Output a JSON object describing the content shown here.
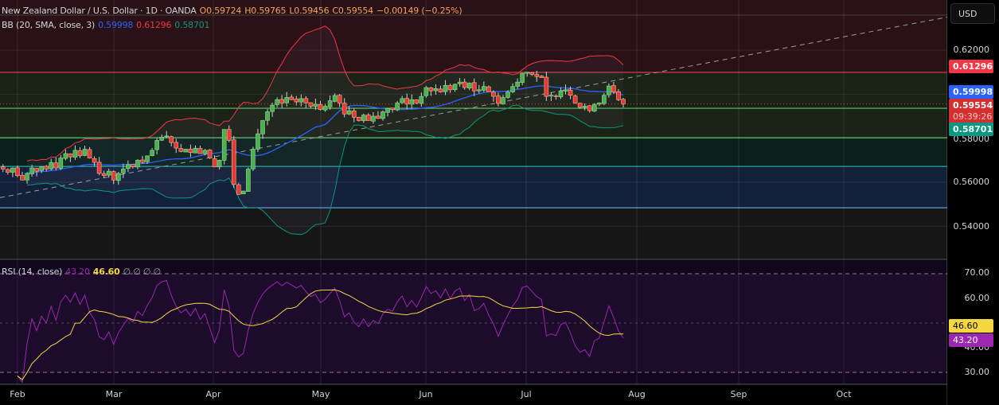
{
  "header": {
    "symbol": "New Zealand Dollar / U.S. Dollar · 1D · OANDA",
    "open_label": "O",
    "open": "0.59724",
    "high_label": "H",
    "high": "0.59765",
    "low_label": "L",
    "low": "0.59456",
    "close_label": "C",
    "close": "0.59554",
    "change": "−0.00149 (−0.25%)"
  },
  "bb_legend": {
    "label": "BB (20, SMA, close, 3)",
    "basis": "0.59998",
    "upper": "0.61296",
    "lower": "0.58701"
  },
  "rsi_legend": {
    "label": "RSI (14, close)",
    "rsi": "43.20",
    "ma": "46.60",
    "extras": "∅ ∅ ∅ ∅"
  },
  "currency_button": "USD",
  "price_axis": [
    "0.62000",
    "0.58000",
    "0.56000",
    "0.54000"
  ],
  "price_badges": {
    "upper": "0.61296",
    "basis": "0.59998",
    "last": "0.59554",
    "countdown": "09:39:26",
    "lower": "0.58701"
  },
  "rsi_axis": [
    "70.00",
    "60.00",
    "40.00",
    "30.00"
  ],
  "rsi_badges": {
    "ma": "46.60",
    "rsi": "43.20"
  },
  "time_axis": [
    "Feb",
    "Mar",
    "Apr",
    "May",
    "Jun",
    "Jul",
    "Aug",
    "Sep",
    "Oct"
  ],
  "colors": {
    "up": "#4caf50",
    "down": "#e53935",
    "bb_basis": "#2962ff",
    "bb_upper": "#f23645",
    "bb_lower": "#089981",
    "rsi": "#9c27b0",
    "rsi_ma": "#f5d742"
  },
  "chart_data": {
    "type": "candlestick",
    "title": "NZD/USD 1D OANDA",
    "ylim": [
      0.53,
      0.64
    ],
    "rsi_ylim": [
      25,
      75
    ],
    "horizontal_levels": [
      0.6099,
      0.5936,
      0.5802,
      0.5672,
      0.5484
    ],
    "trendline": {
      "from": 0.553,
      "to": 0.635
    },
    "closes": [
      0.566,
      0.5645,
      0.5665,
      0.563,
      0.561,
      0.564,
      0.5665,
      0.565,
      0.567,
      0.566,
      0.569,
      0.5665,
      0.571,
      0.573,
      0.5715,
      0.5745,
      0.572,
      0.575,
      0.571,
      0.569,
      0.564,
      0.563,
      0.565,
      0.561,
      0.564,
      0.566,
      0.568,
      0.567,
      0.57,
      0.569,
      0.572,
      0.5745,
      0.579,
      0.5805,
      0.581,
      0.578,
      0.5755,
      0.574,
      0.575,
      0.5735,
      0.5755,
      0.573,
      0.5745,
      0.571,
      0.567,
      0.57,
      0.584,
      0.579,
      0.559,
      0.5545,
      0.556,
      0.566,
      0.575,
      0.582,
      0.588,
      0.592,
      0.595,
      0.5975,
      0.596,
      0.5985,
      0.5975,
      0.5965,
      0.598,
      0.596,
      0.5945,
      0.5955,
      0.593,
      0.5945,
      0.597,
      0.5994,
      0.596,
      0.591,
      0.5925,
      0.5895,
      0.588,
      0.5905,
      0.588,
      0.59,
      0.589,
      0.592,
      0.5935,
      0.593,
      0.596,
      0.598,
      0.5955,
      0.5975,
      0.596,
      0.599,
      0.603,
      0.6015,
      0.6025,
      0.601,
      0.604,
      0.602,
      0.6045,
      0.6055,
      0.603,
      0.605,
      0.6015,
      0.602,
      0.6035,
      0.601,
      0.599,
      0.5958,
      0.5985,
      0.601,
      0.6035,
      0.6055,
      0.6095,
      0.61,
      0.609,
      0.608,
      0.6075,
      0.599,
      0.5995,
      0.599,
      0.6015,
      0.602,
      0.5995,
      0.596,
      0.594,
      0.5945,
      0.5925,
      0.5955,
      0.596,
      0.5995,
      0.6037,
      0.601,
      0.5975,
      0.5955
    ]
  }
}
